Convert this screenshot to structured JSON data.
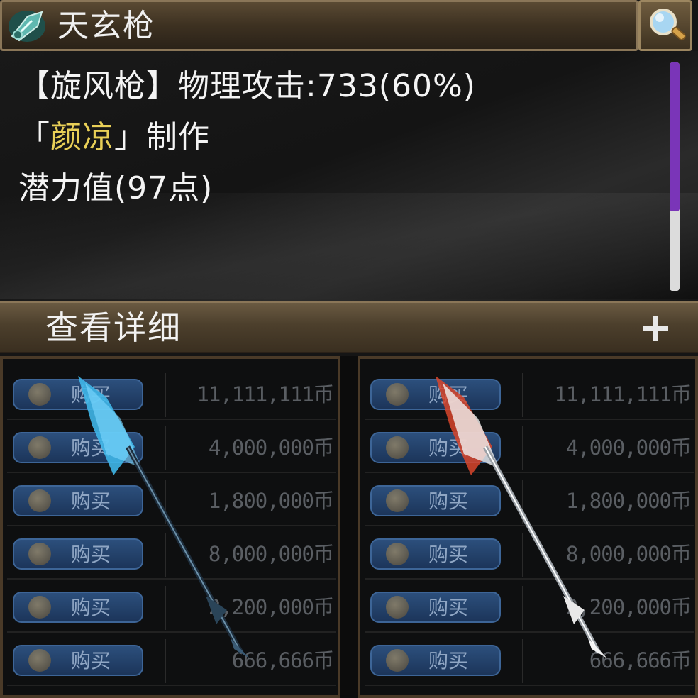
{
  "header": {
    "title": "天玄枪",
    "weapon_icon": "weapon-icon",
    "search_icon": "magnifier-icon"
  },
  "info": {
    "line1": "【旋风枪】物理攻击:733(60%)",
    "maker_prefix": "「",
    "maker_name": "颜凉",
    "maker_suffix": "」制作",
    "line3": "潜力值(97点)"
  },
  "detail": {
    "label": "查看详细",
    "expand_icon": "plus-icon"
  },
  "shop_left": {
    "rows": [
      {
        "buy": "购买",
        "price": "11,111,111币"
      },
      {
        "buy": "购买",
        "price": "4,000,000币"
      },
      {
        "buy": "购买",
        "price": "1,800,000币"
      },
      {
        "buy": "购买",
        "price": "8,000,000币"
      },
      {
        "buy": "购买",
        "price": "2,200,000币"
      },
      {
        "buy": "购买",
        "price": "666,666币"
      }
    ],
    "spear_color": "#3fb6e8"
  },
  "shop_right": {
    "rows": [
      {
        "buy": "购买",
        "price": "11,111,111币"
      },
      {
        "buy": "购买",
        "price": "4,000,000币"
      },
      {
        "buy": "购买",
        "price": "1,800,000币"
      },
      {
        "buy": "购买",
        "price": "8,000,000币"
      },
      {
        "buy": "购买",
        "price": "2,200,000币"
      },
      {
        "buy": "购买",
        "price": "666,666币"
      }
    ],
    "spear_color": "#d8452c"
  },
  "colors": {
    "title_bar": "#4a3c29",
    "maker_highlight": "#e8cf57",
    "scroll_thumb": "#7a35b8",
    "buy_button": "#24436b"
  }
}
